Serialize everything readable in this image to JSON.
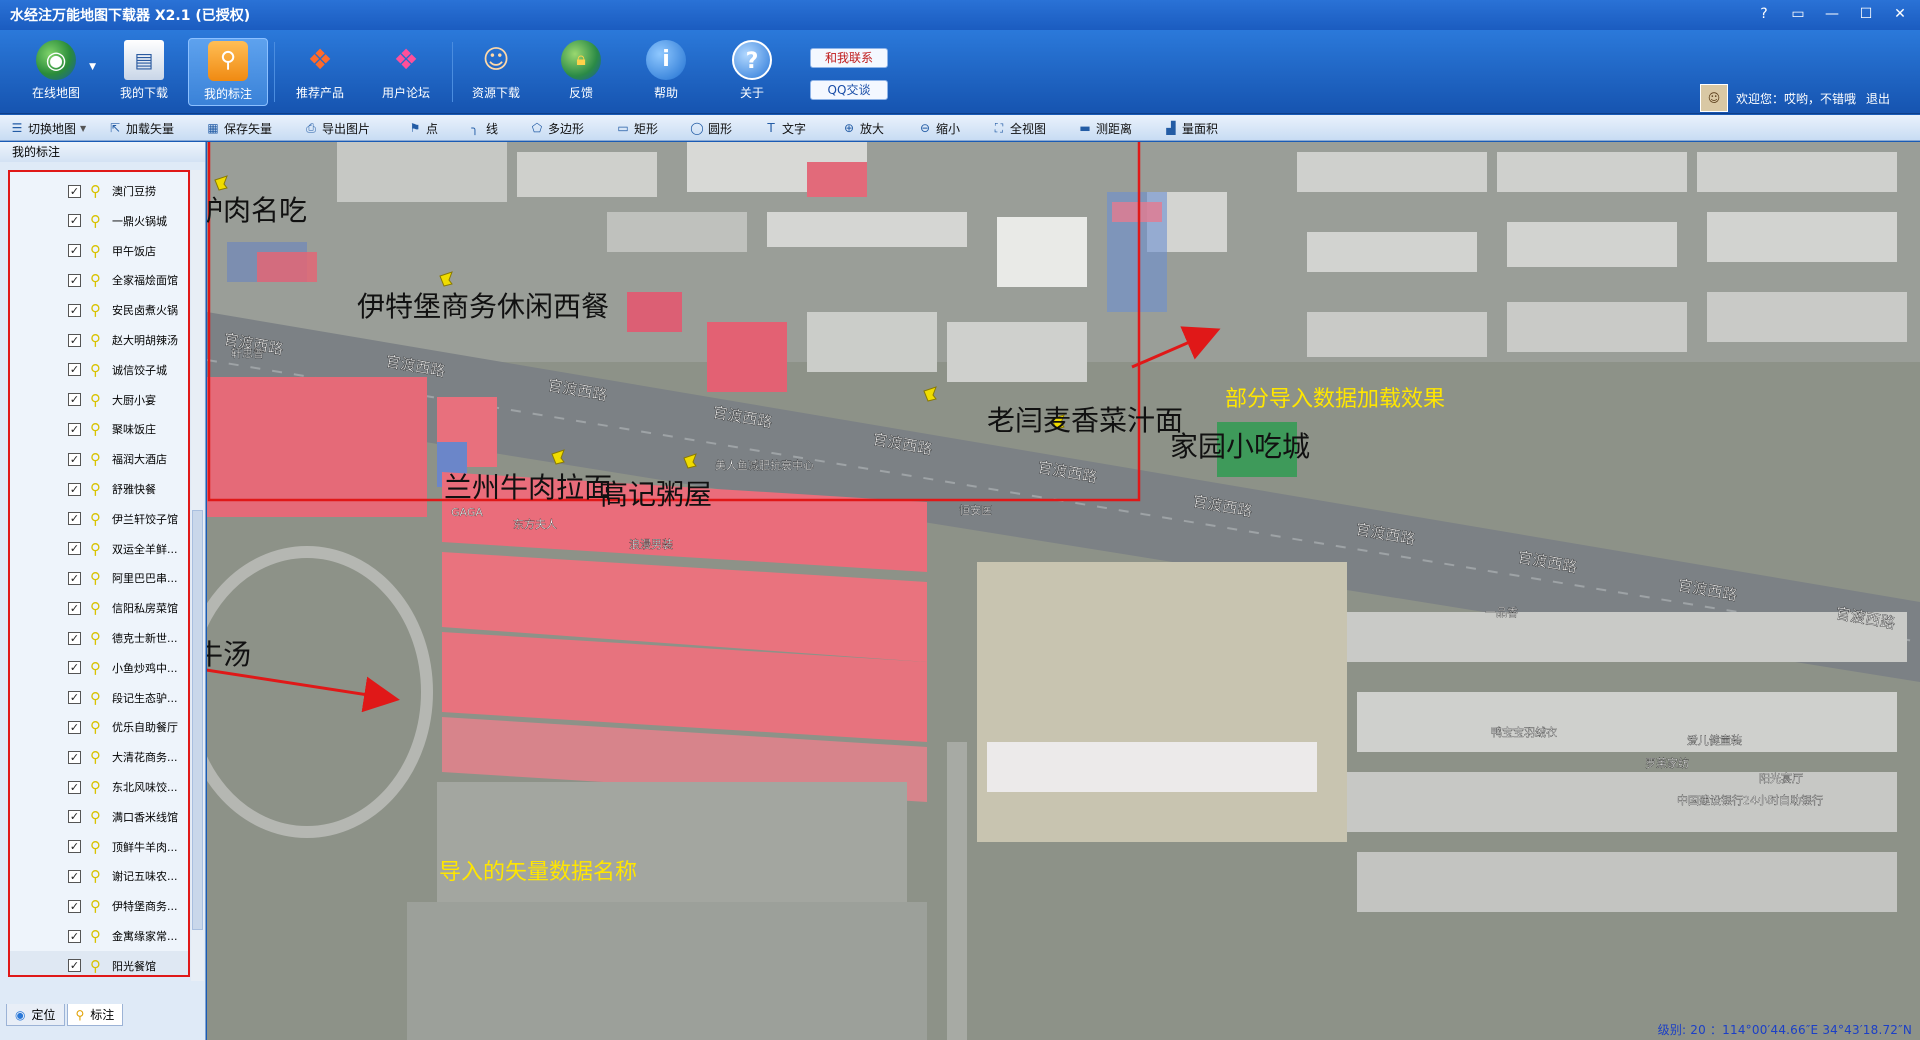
{
  "app": {
    "title": "水经注万能地图下载器 X2.1 (已授权)",
    "window_buttons": [
      "?",
      "▭",
      "—",
      "☐",
      "✕"
    ]
  },
  "toolbar": {
    "buttons": [
      {
        "label": "在线地图",
        "icon": "globe-icon"
      },
      {
        "label": "我的下载",
        "icon": "downloads-icon"
      },
      {
        "label": "我的标注",
        "icon": "map-marker-icon",
        "active": true
      },
      {
        "label": "推荐产品",
        "icon": "cubes-icon"
      },
      {
        "label": "用户论坛",
        "icon": "forum-icon"
      },
      {
        "label": "资源下载",
        "icon": "users-icon"
      },
      {
        "label": "反馈",
        "icon": "lock-globe-icon"
      },
      {
        "label": "帮助",
        "icon": "info-icon"
      },
      {
        "label": "关于",
        "icon": "question-icon"
      }
    ],
    "contact_label": "和我联系",
    "qq_label": "QQ交谈"
  },
  "user": {
    "welcome": "欢迎您：哎哟，不错哦",
    "logout": "退出"
  },
  "subtoolbar": {
    "items": [
      "切换地图",
      "加载矢量",
      "保存矢量",
      "导出图片",
      "点",
      "线",
      "多边形",
      "矩形",
      "圆形",
      "文字",
      "放大",
      "缩小",
      "全视图",
      "测距离",
      "量面积"
    ]
  },
  "sidebar": {
    "header": "我的标注",
    "items": [
      "澳门豆捞",
      "一鼎火锅城",
      "甲午饭店",
      "全家福烩面馆",
      "安民卤煮火锅",
      "赵大明胡辣汤",
      "诚信饺子城",
      "大厨小宴",
      "聚味饭庄",
      "福润大酒店",
      "舒雅快餐",
      "伊兰轩饺子馆",
      "双运全羊鲜...",
      "阿里巴巴串...",
      "信阳私房菜馆",
      "德克士新世...",
      "小鱼炒鸡中...",
      "段记生态驴...",
      "优乐自助餐厅",
      "大清花商务...",
      "东北风味饺...",
      "满口香米线馆",
      "顶鲜牛羊肉...",
      "谢记五味农...",
      "伊特堡商务...",
      "金寓缘家常...",
      "阳光餐馆"
    ],
    "tabs": [
      "定位",
      "标注"
    ]
  },
  "map": {
    "labels_large": [
      "驴肉名吃",
      "伊特堡商务休闲西餐",
      "老闫麦香菜汁面",
      "家园小吃城",
      "兰州牛肉拉面",
      "高记粥屋",
      "牛汤"
    ],
    "roads": [
      "官渡西路",
      "官渡西路",
      "官渡西路",
      "官渡西路",
      "官渡西路",
      "官渡西路",
      "官渡西路",
      "官渡西路",
      "官渡西路",
      "官渡西路",
      "官渡西路",
      "官渡西路"
    ],
    "pois": [
      "轩思普",
      "美人鱼减肥抗衰中心",
      "GAGA",
      "东方夫人",
      "浪漫男装",
      "恒安医",
      "一品香",
      "鸭宝宝羽绒衣",
      "爱儿健童装",
      "罗莱家纺",
      "阳光宴厅",
      "中国建设银行24小时自助银行"
    ],
    "annotation_right": "部分导入数据加载效果",
    "annotation_left": "导入的矢量数据名称",
    "status": "级别: 20 ：114°00′44.66″E    34°43′18.72″N"
  },
  "colors": {
    "title_bar": "#2a72d6",
    "highlight_red": "#e01818",
    "annotation_text": "#ffe600",
    "pin_yellow": "#e8d400"
  }
}
